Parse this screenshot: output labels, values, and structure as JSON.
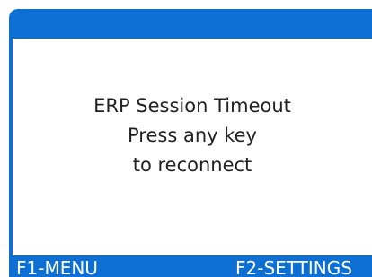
{
  "message": {
    "line1": "ERP Session Timeout",
    "line2": "Press any key",
    "line3": "to reconnect"
  },
  "softkeys": {
    "left": "F1-MENU",
    "right": "F2-SETTINGS"
  },
  "colors": {
    "bar": "#0d6fd4",
    "background": "#ffffff",
    "text": "#222222",
    "softkey_text": "#ffffff"
  }
}
